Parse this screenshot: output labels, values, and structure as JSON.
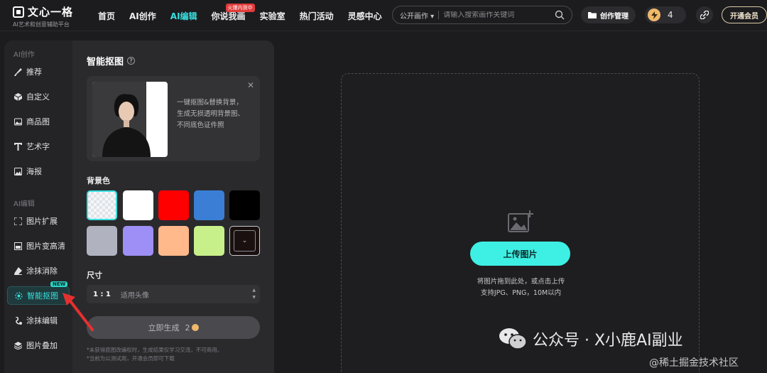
{
  "brand": {
    "name": "文心一格",
    "tagline": "AI艺术和创意辅助平台"
  },
  "nav": {
    "items": [
      {
        "label": "首页"
      },
      {
        "label": "AI创作"
      },
      {
        "label": "AI编辑"
      },
      {
        "label": "你说我画"
      },
      {
        "label": "实验室"
      },
      {
        "label": "热门活动"
      },
      {
        "label": "灵感中心"
      }
    ],
    "active_index": 2,
    "hot_badge": "火爆内测中"
  },
  "search": {
    "scope": "公开画作",
    "placeholder": "请输入搜索画作关键词"
  },
  "header": {
    "create_mgmt": "创作管理",
    "credits": "4",
    "vip": "开通会员"
  },
  "sidebar": {
    "section_create": "AI创作",
    "create_items": [
      {
        "label": "推荐",
        "icon": "brush-icon"
      },
      {
        "label": "自定义",
        "icon": "cube-icon"
      },
      {
        "label": "商品图",
        "icon": "image-icon"
      },
      {
        "label": "艺术字",
        "icon": "text-icon"
      },
      {
        "label": "海报",
        "icon": "poster-icon"
      }
    ],
    "section_edit": "AI编辑",
    "edit_items": [
      {
        "label": "图片扩展",
        "icon": "expand-icon"
      },
      {
        "label": "图片变高清",
        "icon": "hd-icon"
      },
      {
        "label": "涂抹消除",
        "icon": "eraser-icon"
      },
      {
        "label": "智能抠图",
        "icon": "cutout-icon",
        "active": true,
        "badge": "NEW"
      },
      {
        "label": "涂抹编辑",
        "icon": "paint-icon"
      },
      {
        "label": "图片叠加",
        "icon": "layers-icon"
      }
    ]
  },
  "tool": {
    "title": "智能抠图",
    "demo_text": "一键抠图&替换背景，生成无损透明背景图、不同底色证件照",
    "bg_label": "背景色",
    "swatches": [
      "transparent",
      "#ffffff",
      "#ff0000",
      "#3a7fd5",
      "#000000",
      "#b0b3bf",
      "#9d8ff5",
      "#ffb98a",
      "#c8f08a",
      "custom"
    ],
    "selected_swatch": 0,
    "size_label": "尺寸",
    "size_ratio": "1 : 1",
    "size_desc": "适用头像",
    "generate_label": "立即生成",
    "generate_cost": "2",
    "note1": "*未获得底图改编权时，生成结果仅学习交流，不可商用。",
    "note2": "*当前为公测试用，开通会员即可下载"
  },
  "upload": {
    "button": "上传图片",
    "hint1": "将图片拖到此处，或点击上传",
    "hint2": "支持JPG、PNG，10M以内"
  },
  "watermark": {
    "text": "公众号 · X小鹿AI副业",
    "credit": "@稀土掘金技术社区"
  },
  "colors": {
    "accent": "#38e0e0",
    "upload_button": "#3ef0e4",
    "hot_badge": "#e23b3b"
  }
}
